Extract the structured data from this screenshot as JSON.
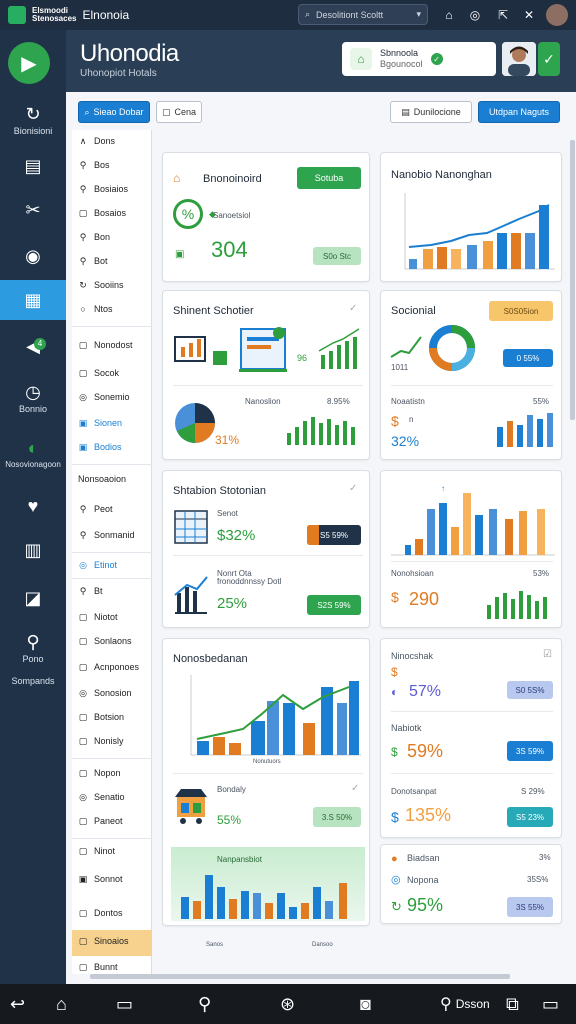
{
  "topbar": {
    "brand_line1": "Elsmoodi",
    "brand_line2": "Stenosaces",
    "title": "Elnonoia",
    "search_text": "Desolitiont Scoltt"
  },
  "sidebar": {
    "items": [
      {
        "label": "",
        "icon": "logo-icon"
      },
      {
        "label": "Bionisioni",
        "icon": "refresh-icon"
      },
      {
        "label": "",
        "icon": "grid-icon"
      },
      {
        "label": "",
        "icon": "tools-icon"
      },
      {
        "label": "",
        "icon": "robot-icon"
      },
      {
        "label": "",
        "icon": "document-icon"
      },
      {
        "label": "",
        "icon": "megaphone-icon",
        "badge": "4"
      },
      {
        "label": "Bonnio",
        "icon": "clock-icon"
      },
      {
        "label": "Nosovionagoon",
        "icon": "compass-icon"
      },
      {
        "label": "",
        "icon": "location-icon"
      },
      {
        "label": "",
        "icon": "newspaper-icon"
      },
      {
        "label": "",
        "icon": "box-icon"
      },
      {
        "label": "Pono",
        "icon": "search-icon"
      },
      {
        "label": "Sompands",
        "icon": ""
      }
    ]
  },
  "header": {
    "title": "Uhonodia",
    "subtitle": "Uhonopiot Hotals",
    "user_name": "Sbnnoola",
    "user_sub": "Bgounocol"
  },
  "toolbar": {
    "primary": "Sieao Dobar",
    "secondary": "Cena",
    "export": "Dunilocione",
    "action": "Utdpan Naguts"
  },
  "nav": {
    "items": [
      "Dons",
      "Bos",
      "Bosiaios",
      "Bosaios",
      "Bon",
      "Bot",
      "Sooiins",
      "Ntos",
      "Nonodost",
      "Socok",
      "Sonemio",
      "Sionen",
      "Bodios",
      "Nonsoaoion",
      "Peot",
      "Sonmanid",
      "Etinot",
      "Bt",
      "Niotot",
      "Sonlaons",
      "Acnponoes",
      "Sonosion",
      "Botsion",
      "Nonisly",
      "Nopon",
      "Senatio",
      "Paneot",
      "Ninot",
      "Sonnot",
      "Dontos",
      "Sinoaios",
      "Bunnt"
    ]
  },
  "cards": {
    "c1": {
      "title": "Bnonoinoird",
      "button": "Sotuba",
      "sub": "Sanoetsiol",
      "value": "304",
      "pill": "S0o Stc"
    },
    "c2": {
      "title": "Nanobio Nanonghan"
    },
    "c3": {
      "title": "Shinent Schotier",
      "legend": "Nanoslion",
      "legend_val": "8.95%",
      "pct": "31%"
    },
    "c4": {
      "title": "Socionial",
      "pill": "S0S05ion",
      "sub": "1011",
      "pill2": "0 55%",
      "row_label": "Noaatistn",
      "row_val": "55%",
      "pct": "32%",
      "pct_icon": "$",
      "small_label": "n"
    },
    "c5": {
      "title": "Shtabion Stotonian",
      "sub": "Senot",
      "value": "$32%",
      "pill": "S5 59%",
      "sub2": "Nonrt Ota",
      "sub3": "fronoddnnssy Dotl",
      "value2": "25%",
      "pill2": "S2S 59%"
    },
    "c6": {
      "label": "Nonohsioan",
      "val": "53%",
      "value": "290",
      "icon": "$"
    },
    "c7": {
      "title": "Nonosbedanan",
      "sub": "Bondaly",
      "value": "55%",
      "pill": "3.S 50%",
      "axis": "Nonutuors"
    },
    "c8": {
      "label": "Ninocshak",
      "pct": "57%",
      "pill": "S0 5S%"
    },
    "c9": {
      "label": "Nabiotk",
      "pct": "59%",
      "pill": "3S 59%"
    },
    "c10": {
      "label": "Donotsanpat",
      "val": "S 29%",
      "pct": "135%",
      "pill": "S5 23%"
    },
    "c11": {
      "label": "Nabiotk",
      "chart_label": "Nanpansbiot"
    },
    "c12": {
      "row1": "Biadsan",
      "row1_val": "3%",
      "row2": "Nopona",
      "row2_val": "35S%",
      "pct": "95%",
      "pill": "3S 55%"
    },
    "footer": {
      "a": "Sanos",
      "b": "Dansoo"
    }
  },
  "bottombar": {
    "label": "Dsson"
  },
  "colors": {
    "accent": "#1a7fd2",
    "green": "#2e9e3c",
    "orange": "#e07b22",
    "sidebar": "#1f3248"
  }
}
